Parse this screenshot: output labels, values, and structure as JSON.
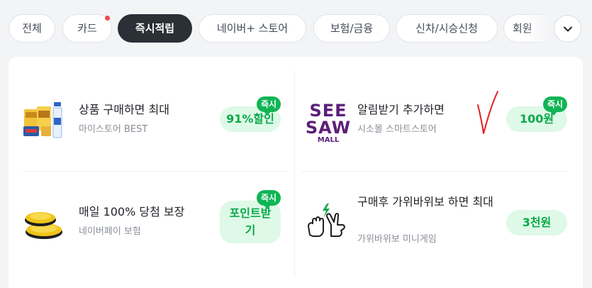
{
  "tabs": [
    {
      "label": "전체",
      "active": false
    },
    {
      "label": "카드",
      "active": false,
      "has_new_dot": true
    },
    {
      "label": "즉시적립",
      "active": true
    },
    {
      "label": "네이버+ 스토어",
      "active": false
    },
    {
      "label": "보험/금융",
      "active": false
    },
    {
      "label": "신차/시승신청",
      "active": false
    },
    {
      "label": "회원",
      "active": false
    }
  ],
  "more_button": {
    "icon": "chevron-down-icon"
  },
  "offers": [
    {
      "title": "상품 구매하면 최대",
      "subtitle": "마이스토어 BEST",
      "reward": "91%할인",
      "badge": "즉시",
      "thumb": "product-box-icon"
    },
    {
      "title": "알림받기 추가하면",
      "subtitle": "시소몰 스마트스토어",
      "reward": "100원",
      "badge": "즉시",
      "logo_text": [
        "SEE",
        "SAW",
        "MALL"
      ],
      "thumb": "seesaw-mall-logo"
    },
    {
      "title": "매일 100% 당첨 보장",
      "subtitle": "네이버페이 보험",
      "reward": "포인트받기",
      "badge": "즉시",
      "thumb": "gold-coins-icon"
    },
    {
      "title": "구매후 가위바위보 하면 최대",
      "subtitle": "가위바위보 미니게임",
      "reward": "3천원",
      "thumb": "rock-paper-scissors-icon"
    }
  ],
  "colors": {
    "accent_green": "#10b554",
    "pill_bg": "#def9e7",
    "pill_text": "#0ba94a",
    "active_tab": "#2b2f36",
    "new_dot": "#f2494a",
    "logo_purple": "#5b1f7a",
    "annotation_red": "#e02020"
  }
}
